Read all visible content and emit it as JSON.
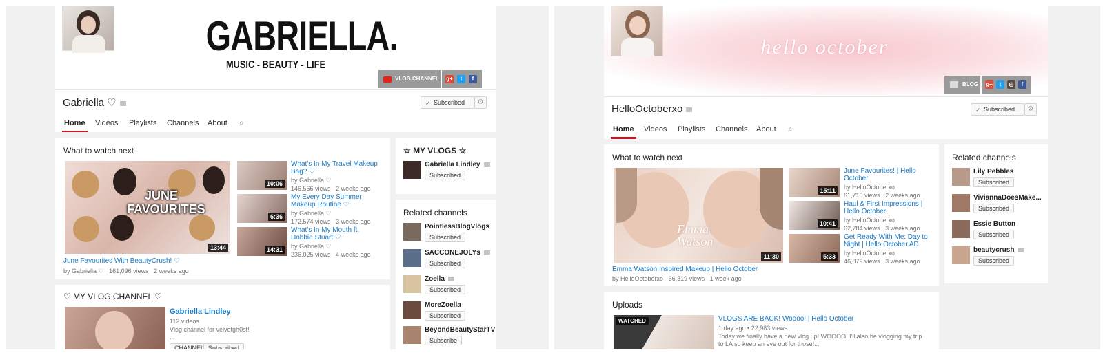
{
  "left": {
    "banner": {
      "title": "GABRIELLA.",
      "subtitle": "MUSIC - BEAUTY - LIFE",
      "vlog_link": "VLOG CHANNEL"
    },
    "channel": {
      "name": "Gabriella ♡",
      "subscribed": "Subscribed"
    },
    "tabs": [
      "Home",
      "Videos",
      "Playlists",
      "Channels",
      "About"
    ],
    "watch_next": {
      "heading": "What to watch next",
      "featured": {
        "thumb_text": [
          "JUNE",
          "FAVOURITES"
        ],
        "duration": "13:44",
        "title": "June Favourites With BeautyCrush! ♡",
        "by": "by Gabriella ♡",
        "views": "161,096 views",
        "age": "2 weeks ago"
      },
      "videos": [
        {
          "title1": "What's In My Travel Makeup",
          "title2": "Bag? ♡",
          "by": "by Gabriella ♡",
          "views": "146,566 views",
          "age": "2 weeks ago",
          "duration": "10:06"
        },
        {
          "title1": "My Every Day Summer",
          "title2": "Makeup Routine ♡",
          "by": "by Gabriella ♡",
          "views": "172,574 views",
          "age": "3 weeks ago",
          "duration": "6:36"
        },
        {
          "title1": "What's In My Mouth ft.",
          "title2": "Hobbie Stuart ♡",
          "by": "by Gabriella ♡",
          "views": "236,025 views",
          "age": "4 weeks ago",
          "duration": "14:31"
        }
      ]
    },
    "vlog_section": {
      "heading": "♡ MY VLOG CHANNEL ♡",
      "channel": "Gabriella Lindley",
      "videos": "112 videos",
      "desc": "Vlog channel for velvetgh0st!",
      "more": "...",
      "channel_btn": "CHANNEL",
      "subscribed": "Subscribed"
    },
    "my_vlogs": {
      "heading": "☆ MY VLOGS ☆",
      "name": "Gabriella Lindley",
      "subscribed": "Subscribed"
    },
    "related": {
      "heading": "Related channels",
      "items": [
        {
          "name": "PointlessBlogVlogs",
          "btn": "Subscribed",
          "verified": false
        },
        {
          "name": "SACCONEJOLYs",
          "btn": "Subscribed",
          "verified": true
        },
        {
          "name": "Zoella",
          "btn": "Subscribed",
          "verified": true
        },
        {
          "name": "MoreZoella",
          "btn": "Subscribed",
          "verified": false
        },
        {
          "name": "BeyondBeautyStarTV",
          "btn": "Subscribe",
          "verified": false
        }
      ]
    }
  },
  "right": {
    "banner": {
      "script": "hello october",
      "blog_link": "BLOG"
    },
    "channel": {
      "name": "HelloOctoberxo",
      "subscribed": "Subscribed"
    },
    "tabs": [
      "Home",
      "Videos",
      "Playlists",
      "Channels",
      "About"
    ],
    "watch_next": {
      "heading": "What to watch next",
      "featured": {
        "overlay1": "Emma",
        "overlay2": "Watson",
        "duration": "11:30",
        "title": "Emma Watson Inspired Makeup | Hello October",
        "by": "by HelloOctoberxo",
        "views": "66,319 views",
        "age": "1 week ago"
      },
      "videos": [
        {
          "title1": "June Favourites! | Hello",
          "title2": "October",
          "by": "by HelloOctoberxo",
          "views": "61,710 views",
          "age": "2 weeks ago",
          "duration": "15:11"
        },
        {
          "title1": "Haul & First Impressions |",
          "title2": "Hello October",
          "by": "by HelloOctoberxo",
          "views": "62,784 views",
          "age": "3 weeks ago",
          "duration": "10:41"
        },
        {
          "title1": "Get Ready With Me: Day to",
          "title2": "Night | Hello October AD",
          "by": "by HelloOctoberxo",
          "views": "46,879 views",
          "age": "3 weeks ago",
          "duration": "5:33"
        }
      ]
    },
    "uploads": {
      "heading": "Uploads",
      "watched": "WATCHED",
      "title": "VLOGS ARE BACK! Woooo! | Hello October",
      "age": "1 day ago",
      "views": "22,983 views",
      "desc1": "Today we finally have a new vlog up! WOOOO! I'll also be vlogging my trip",
      "desc2": "to LA so keep an eye out for those!..."
    },
    "related": {
      "heading": "Related channels",
      "items": [
        {
          "name": "Lily Pebbles",
          "btn": "Subscribed",
          "verified": false
        },
        {
          "name": "ViviannaDoesMake...",
          "btn": "Subscribed",
          "verified": false
        },
        {
          "name": "Essie Button",
          "btn": "Subscribed",
          "verified": false
        },
        {
          "name": "beautycrush",
          "btn": "Subscribed",
          "verified": true
        }
      ]
    }
  },
  "colors": {
    "link": "#167ac6",
    "tab_underline": "#cc181e",
    "youtube_red": "#e62117",
    "gplus": "#dd4b39",
    "twitter": "#1da1f2",
    "facebook": "#3b5998",
    "instagram": "#5b4a3f"
  }
}
